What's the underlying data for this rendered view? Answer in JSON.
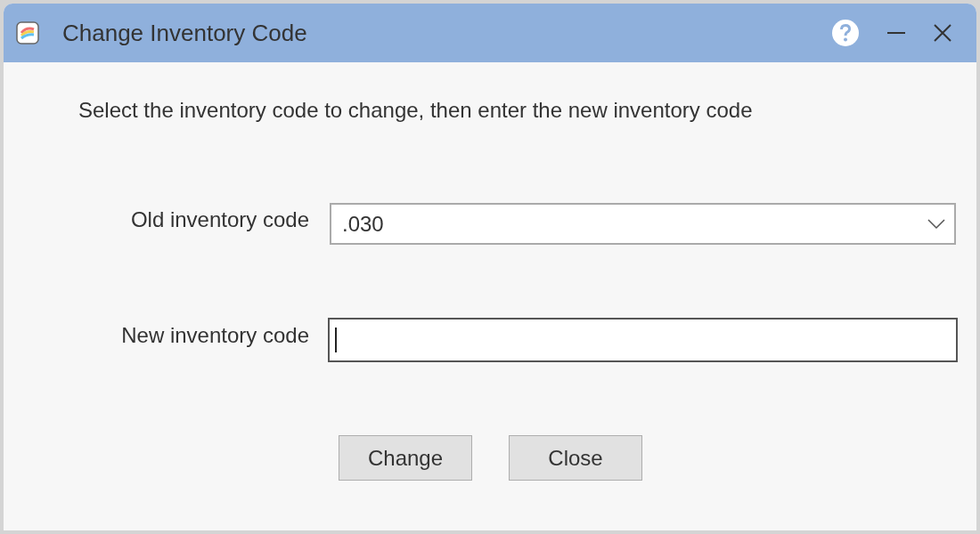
{
  "window": {
    "title": "Change Inventory Code"
  },
  "instruction": "Select the inventory code to change, then enter the new inventory code",
  "fields": [
    {
      "kind": "dropdown",
      "label": "Old inventory code",
      "value": ".030",
      "focused": false
    },
    {
      "kind": "text",
      "label": "New inventory code",
      "focused": true
    }
  ],
  "buttons": [
    "Change",
    "Close"
  ]
}
